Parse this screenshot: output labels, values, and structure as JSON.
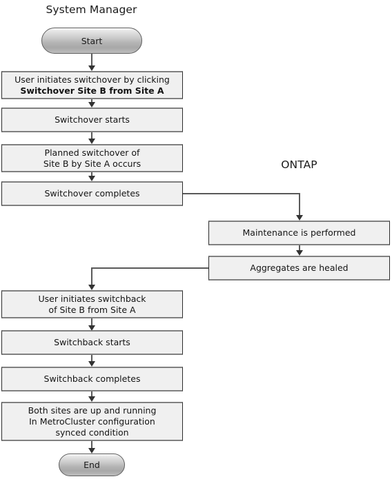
{
  "diagram": {
    "title_system_manager": "System Manager",
    "title_ontap": "ONTAP",
    "lanes": [
      {
        "id": "system-manager",
        "label": "System Manager"
      },
      {
        "id": "ontap",
        "label": "ONTAP"
      }
    ],
    "nodes": {
      "start": {
        "label": "Start",
        "shape": "terminator",
        "lane": "system-manager"
      },
      "user_initiates_switchover": {
        "line1": "User initiates switchover by clicking",
        "line2": "Switchover Site B from Site A",
        "line2_bold": true,
        "shape": "process",
        "lane": "system-manager"
      },
      "switchover_starts": {
        "line1": "Switchover starts",
        "shape": "process",
        "lane": "system-manager"
      },
      "planned_switchover": {
        "line1": "Planned switchover of",
        "line2": "Site B by Site A occurs",
        "shape": "process",
        "lane": "system-manager"
      },
      "switchover_completes": {
        "line1": "Switchover completes",
        "shape": "process",
        "lane": "system-manager"
      },
      "maintenance_performed": {
        "line1": "Maintenance is performed",
        "shape": "process",
        "lane": "ontap"
      },
      "aggregates_healed": {
        "line1": "Aggregates are healed",
        "shape": "process",
        "lane": "ontap"
      },
      "user_initiates_switchback": {
        "line1": "User initiates switchback",
        "line2": "of Site B from Site A",
        "shape": "process",
        "lane": "system-manager"
      },
      "switchback_starts": {
        "line1": "Switchback starts",
        "shape": "process",
        "lane": "system-manager"
      },
      "switchback_completes": {
        "line1": "Switchback completes",
        "shape": "process",
        "lane": "system-manager"
      },
      "both_sites_up": {
        "line1": "Both sites are up and running",
        "line2": "In MetroCluster configuration",
        "line3": "synced condition",
        "shape": "process",
        "lane": "system-manager"
      },
      "end": {
        "label": "End",
        "shape": "terminator",
        "lane": "system-manager"
      }
    },
    "colors": {
      "process_fill": "#f0f0f0",
      "process_border": "#2b2b2b",
      "process_shadow": "#808080",
      "terminator_fill": "#bcbcbc",
      "connector": "#595959",
      "arrow": "#333333",
      "text": "#141414",
      "background": "#ffffff"
    }
  }
}
